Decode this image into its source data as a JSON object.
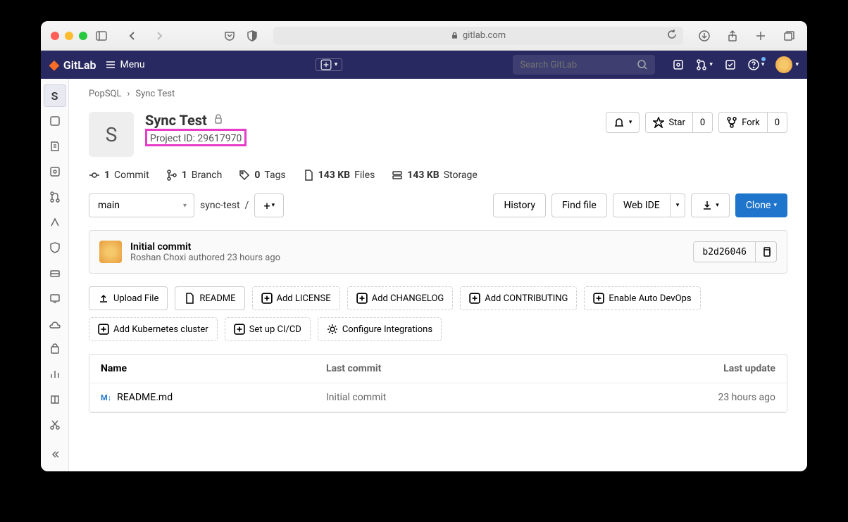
{
  "browser": {
    "url": "gitlab.com"
  },
  "topbar": {
    "brand": "GitLab",
    "menu": "Menu",
    "search_placeholder": "Search GitLab"
  },
  "sidebar": {
    "project_initial": "S"
  },
  "breadcrumb": {
    "group": "PopSQL",
    "project": "Sync Test"
  },
  "project": {
    "avatar": "S",
    "name": "Sync Test",
    "id_label": "Project ID: 29617970",
    "star_label": "Star",
    "star_count": "0",
    "fork_label": "Fork",
    "fork_count": "0"
  },
  "stats": {
    "commits_count": "1",
    "commits_label": "Commit",
    "branch_count": "1",
    "branch_label": "Branch",
    "tags_count": "0",
    "tags_label": "Tags",
    "files_size": "143 KB",
    "files_label": "Files",
    "storage_size": "143 KB",
    "storage_label": "Storage"
  },
  "toolbar": {
    "branch": "main",
    "path": "sync-test",
    "history": "History",
    "find_file": "Find file",
    "web_ide": "Web IDE",
    "clone": "Clone"
  },
  "commit": {
    "title": "Initial commit",
    "author": "Roshan Choxi",
    "authored": "authored",
    "time": "23 hours ago",
    "sha": "b2d26046"
  },
  "quick_actions": {
    "upload": "Upload File",
    "readme": "README",
    "license": "Add LICENSE",
    "changelog": "Add CHANGELOG",
    "contributing": "Add CONTRIBUTING",
    "autodevops": "Enable Auto DevOps",
    "k8s": "Add Kubernetes cluster",
    "cicd": "Set up CI/CD",
    "integrations": "Configure Integrations"
  },
  "file_table": {
    "head_name": "Name",
    "head_commit": "Last commit",
    "head_update": "Last update",
    "rows": [
      {
        "name": "README.md",
        "commit": "Initial commit",
        "update": "23 hours ago"
      }
    ]
  }
}
